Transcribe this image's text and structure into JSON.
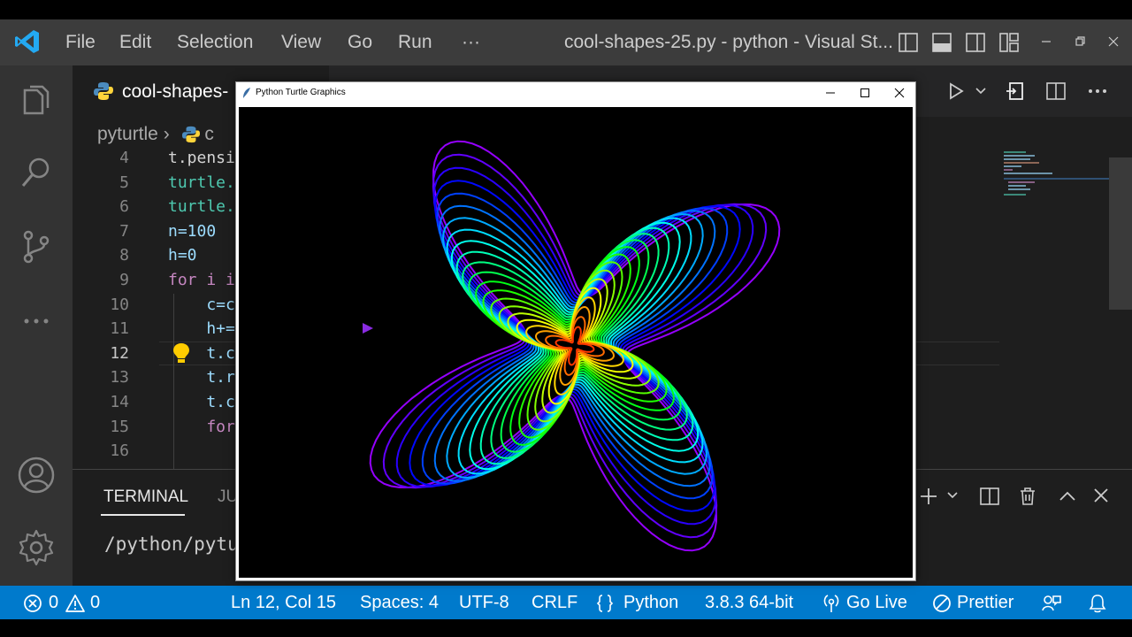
{
  "menu": [
    "File",
    "Edit",
    "Selection",
    "View",
    "Go",
    "Run",
    "···"
  ],
  "window_title": "cool-shapes-25.py - python - Visual St...",
  "tab": {
    "label": "cool-shapes-"
  },
  "breadcrumb": {
    "folder": "pyturtle",
    "file_partial": "c"
  },
  "code_lines": [
    {
      "num": "4",
      "text": "t.pensi"
    },
    {
      "num": "5",
      "text": "turtle."
    },
    {
      "num": "6",
      "text": "turtle."
    },
    {
      "num": "7",
      "text": "n=100"
    },
    {
      "num": "8",
      "text": "h=0"
    },
    {
      "num": "9",
      "text": "for i i"
    },
    {
      "num": "10",
      "text": "    c=c"
    },
    {
      "num": "11",
      "text": "    h+="
    },
    {
      "num": "12",
      "text": "    t.c"
    },
    {
      "num": "13",
      "text": "    t.r"
    },
    {
      "num": "14",
      "text": "    t.c"
    },
    {
      "num": "15",
      "text": "    for"
    },
    {
      "num": "16",
      "text": ""
    }
  ],
  "terminal": {
    "tab_active": "TERMINAL",
    "tab_other": "JU",
    "line": "/python/pytu"
  },
  "turtle_window": {
    "title": "Python Turtle Graphics"
  },
  "status": {
    "errors": "0",
    "warnings": "0",
    "position": "Ln 12, Col 15",
    "spaces": "Spaces: 4",
    "encoding": "UTF-8",
    "eol": "CRLF",
    "language": "Python",
    "interpreter": "3.8.3 64-bit",
    "golive": "Go Live",
    "prettier": "Prettier"
  },
  "colors": {
    "statusbar": "#007acc",
    "titlebar": "#3c3c3c",
    "activitybar": "#333333",
    "editor": "#1e1e1e",
    "vscode_blue": "#23a9f2"
  }
}
